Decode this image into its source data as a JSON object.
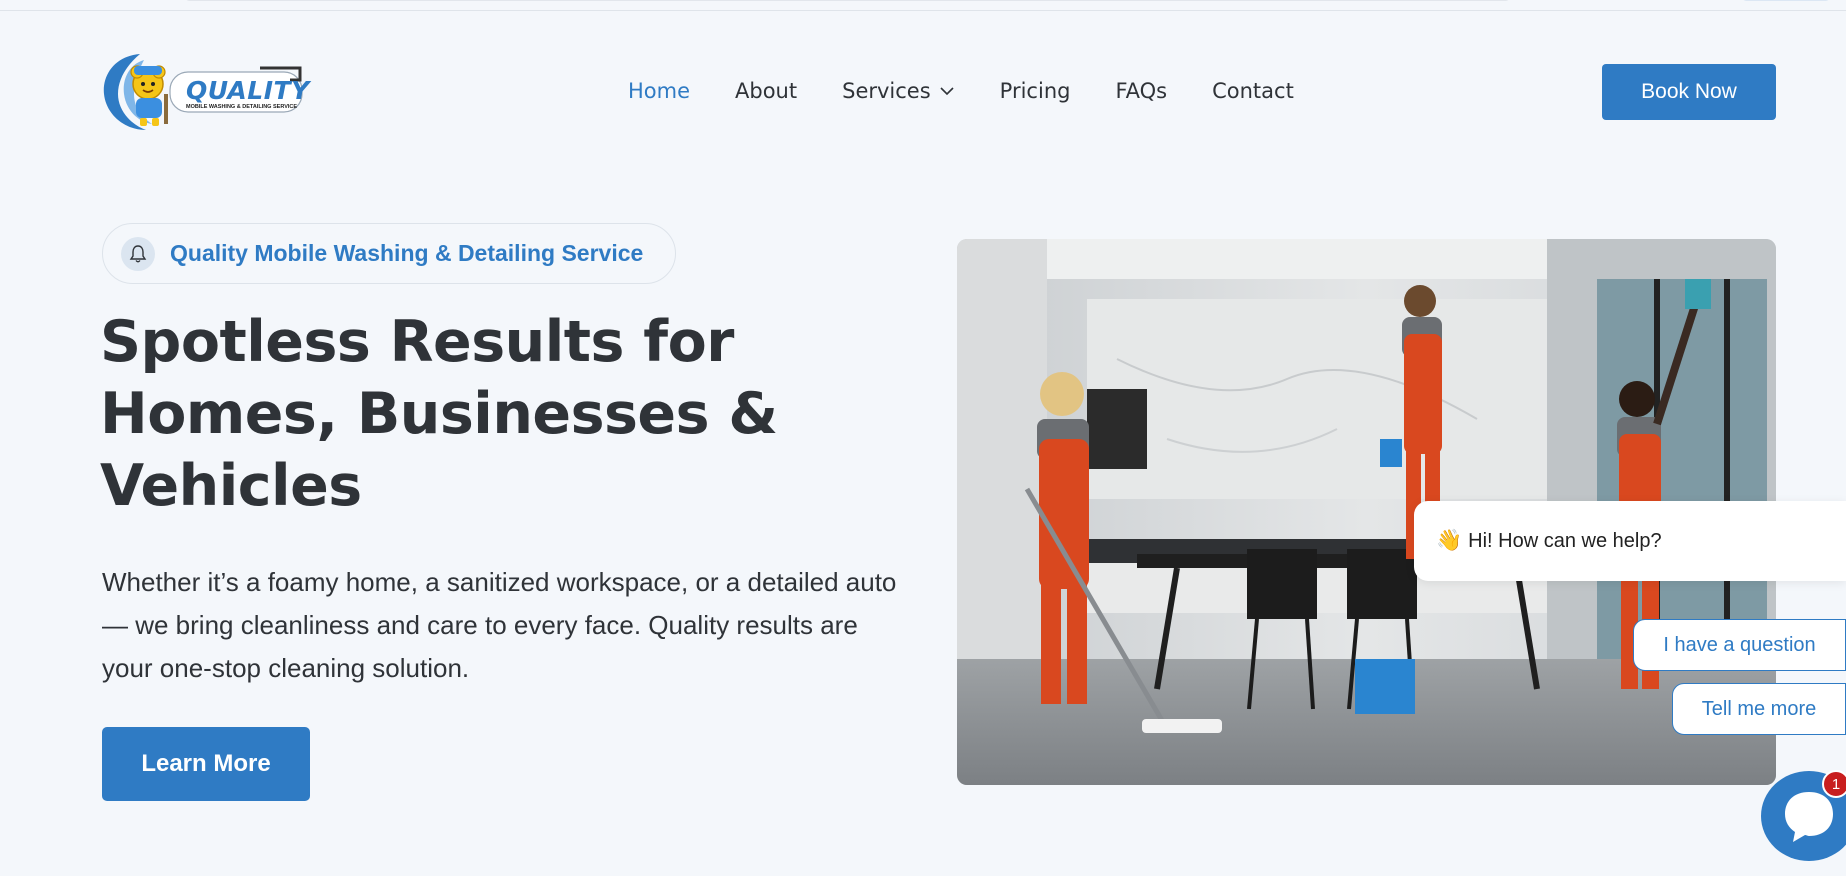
{
  "logo": {
    "brand": "QUALITY",
    "tagline": "MOBILE WASHING & DETAILING SERVICE"
  },
  "nav": {
    "items": [
      {
        "label": "Home",
        "active": true
      },
      {
        "label": "About"
      },
      {
        "label": "Services",
        "has_dropdown": true
      },
      {
        "label": "Pricing"
      },
      {
        "label": "FAQs"
      },
      {
        "label": "Contact"
      }
    ],
    "cta": "Book Now"
  },
  "hero": {
    "badge": "Quality Mobile Washing & Detailing Service",
    "title_lines": [
      "Spotless Results for",
      "Homes, Businesses &",
      "Vehicles"
    ],
    "description_lines": [
      "Whether it’s a foamy home, a sanitized workspace, or a detailed auto",
      "— we bring cleanliness and care to every face. Quality results are",
      "your one-stop cleaning solution."
    ],
    "button": "Learn More"
  },
  "chat": {
    "greeting_emoji": "👋",
    "greeting": "Hi! How can we help?",
    "quick_replies": [
      "I have a question",
      "Tell me more"
    ],
    "notification_count": "1"
  },
  "colors": {
    "accent": "#2f7bc4",
    "text": "#2f3338",
    "background": "#f4f7fb",
    "notification": "#c81e1e"
  }
}
